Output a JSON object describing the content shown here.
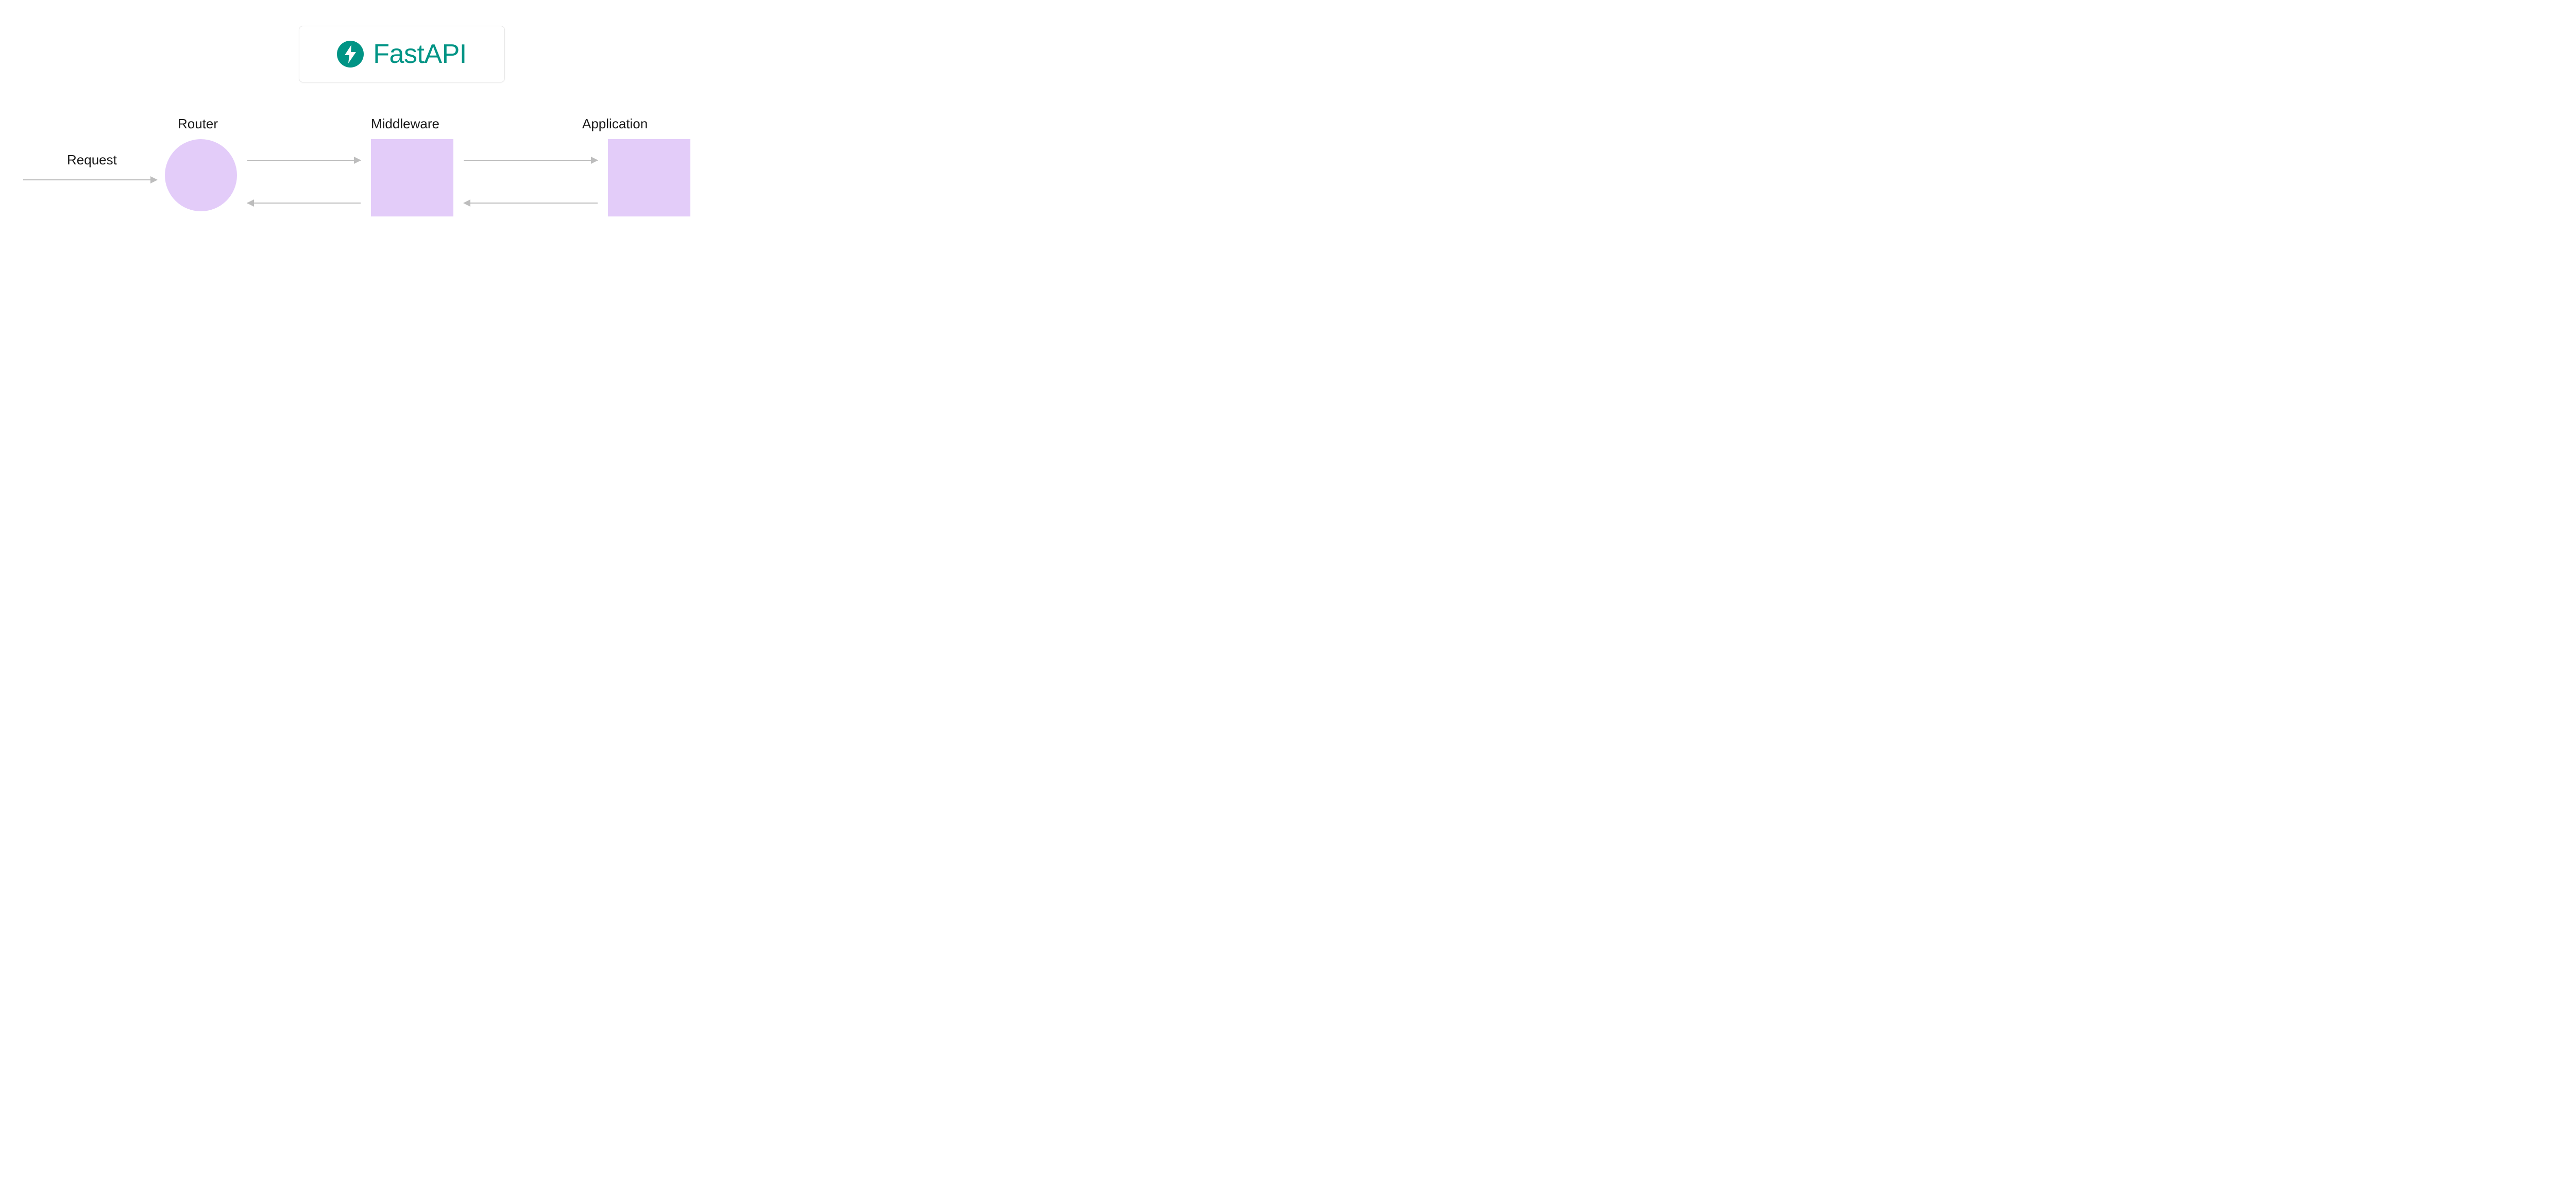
{
  "logo": {
    "name": "FastAPI",
    "icon_name": "lightning-bolt-icon",
    "brand_color": "#009485"
  },
  "labels": {
    "request": "Request",
    "router": "Router",
    "middleware": "Middleware",
    "application": "Application"
  },
  "nodes": [
    {
      "id": "router",
      "shape": "circle",
      "color": "#e3ccf9"
    },
    {
      "id": "middleware",
      "shape": "square",
      "color": "#e3ccf9"
    },
    {
      "id": "application",
      "shape": "square",
      "color": "#e3ccf9"
    }
  ],
  "arrows": [
    {
      "from": "request",
      "to": "router",
      "direction": "right"
    },
    {
      "from": "router",
      "to": "middleware",
      "direction": "right"
    },
    {
      "from": "middleware",
      "to": "router",
      "direction": "left"
    },
    {
      "from": "middleware",
      "to": "application",
      "direction": "right"
    },
    {
      "from": "application",
      "to": "middleware",
      "direction": "left"
    }
  ],
  "colors": {
    "node_fill": "#e3ccf9",
    "arrow": "#bdbdbd",
    "text": "#1a1a1a"
  }
}
